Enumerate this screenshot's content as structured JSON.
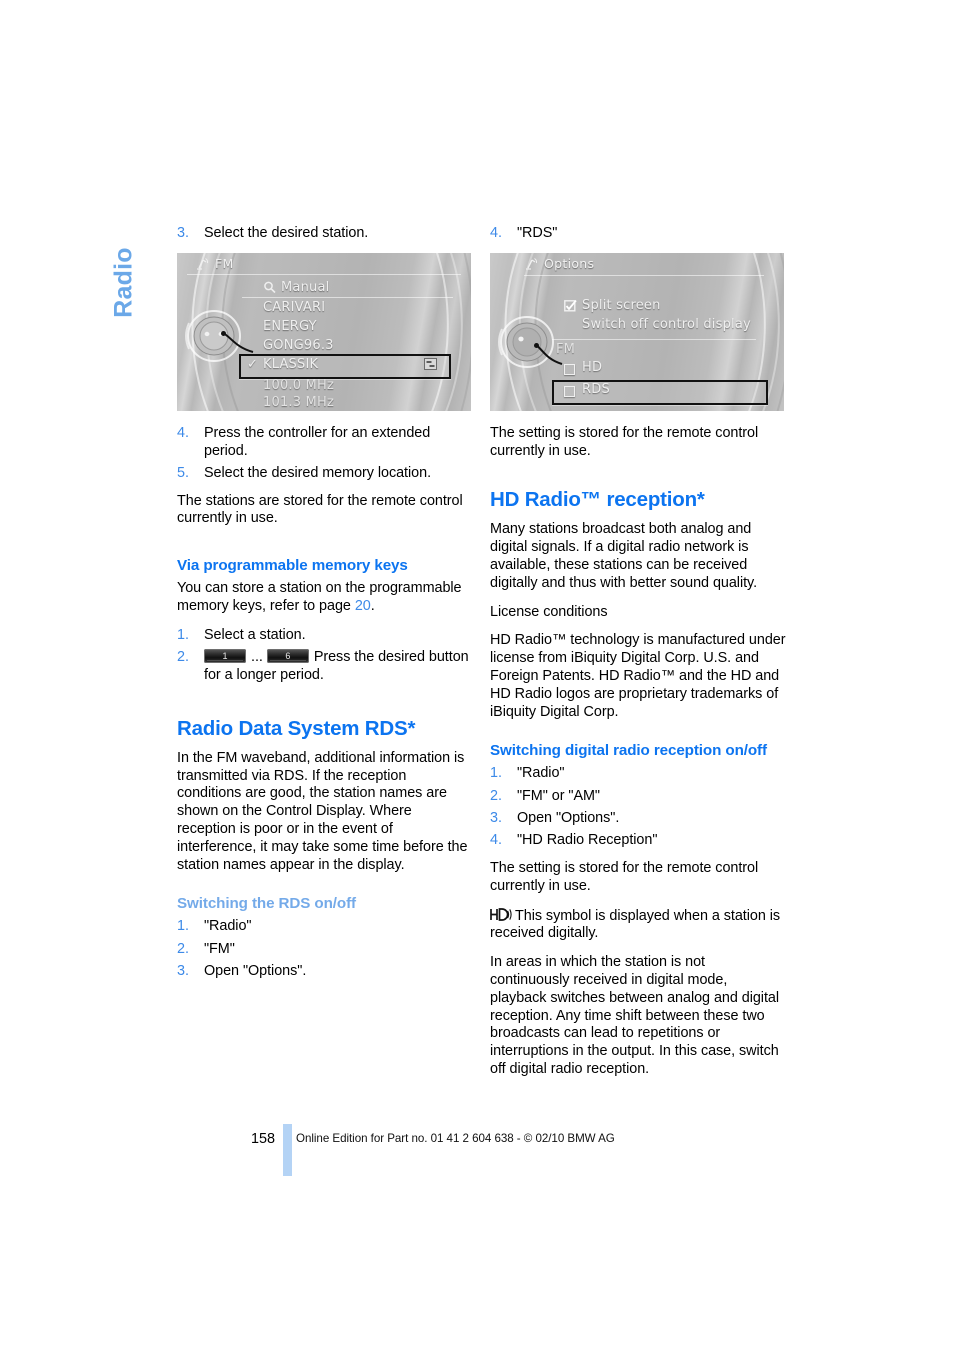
{
  "chapter_tab": "Radio",
  "left_column": {
    "step3": {
      "num": "3.",
      "text": "Select the desired station."
    },
    "screenshot1": {
      "title": "FM",
      "title_icon": "antenna-icon",
      "search_row": "Manual",
      "search_icon": "magnifier-icon",
      "stations": [
        "CARIVARI",
        "ENERGY",
        "GONG96.3"
      ],
      "selected_station": "KLASSIK",
      "selected_check": "✓",
      "selected_badge_icon": "hd-station-icon",
      "frequencies": [
        "100.0  MHz",
        "101.3  MHz"
      ],
      "controller_icon": "idrive-controller-icon"
    },
    "steps_45": [
      {
        "num": "4.",
        "text": "Press the controller for an extended period."
      },
      {
        "num": "5.",
        "text": "Select the desired memory location."
      }
    ],
    "stored_note": "The stations are stored for the remote control currently in use.",
    "memory_keys_heading": "Via programmable memory keys",
    "memory_keys_intro_a": "You can store a station on the programmable memory keys, refer to page ",
    "memory_keys_intro_page": "20",
    "memory_keys_intro_b": ".",
    "memkey_steps": [
      {
        "num": "1.",
        "text": "Select a station."
      }
    ],
    "memkey_step2": {
      "num": "2.",
      "key_first": "1",
      "ellipsis": "...",
      "key_last": "6",
      "text": "Press the desired button for a longer period."
    },
    "rds_heading": "Radio Data System RDS*",
    "rds_body": "In the FM waveband, additional information is transmitted via RDS. If the reception conditions are good, the station names are shown on the Control Display. Where reception is poor or in the event of interference, it may take some time before the station names appear in the display.",
    "rds_switch_heading": "Switching the RDS on/off",
    "rds_switch_steps": [
      {
        "num": "1.",
        "text": "\"Radio\""
      },
      {
        "num": "2.",
        "text": "\"FM\""
      },
      {
        "num": "3.",
        "text": "Open \"Options\"."
      }
    ]
  },
  "right_column": {
    "step4": {
      "num": "4.",
      "text": "\"RDS\""
    },
    "screenshot2": {
      "title": "Options",
      "title_icon": "antenna-icon",
      "split_screen_label": "Split screen",
      "split_screen_checked": true,
      "switch_off_label": "Switch off control display",
      "group_label": "FM",
      "hd_label": "HD",
      "hd_checked": false,
      "rds_label": "RDS",
      "rds_checked": false,
      "controller_icon": "idrive-controller-icon"
    },
    "stored_note": "The setting is stored for the remote control currently in use.",
    "hd_heading": "HD Radio™ reception*",
    "hd_body": "Many stations broadcast both analog and digital signals. If a digital radio network is available, these stations can be received digitally and thus with better sound quality.",
    "license_label": "License conditions",
    "license_body": "HD Radio™ technology is manufactured under license from iBiquity Digital Corp. U.S. and Foreign Patents. HD Radio™ and the HD and HD Radio logos are proprietary trademarks of iBiquity Digital Corp.",
    "switch_heading": "Switching digital radio reception on/off",
    "switch_steps": [
      {
        "num": "1.",
        "text": "\"Radio\""
      },
      {
        "num": "2.",
        "text": "\"FM\" or \"AM\""
      },
      {
        "num": "3.",
        "text": "Open \"Options\"."
      },
      {
        "num": "4.",
        "text": "\"HD Radio Reception\""
      }
    ],
    "stored_note2": "The setting is stored for the remote control currently in use.",
    "symbol_note": "This symbol is displayed when a station is received digitally.",
    "symbol_icon": "hd-radio-logo-icon",
    "final_body": "In areas in which the station is not continuously received in digital mode, playback switches between analog and digital reception. Any time shift between these two broadcasts can lead to repetitions or interruptions in the output. In this case, switch off digital radio reception."
  },
  "footer": {
    "page_number": "158",
    "text": "Online Edition for Part no. 01 41 2 604 638 - © 02/10 BMW AG"
  },
  "colors": {
    "heading_blue": "#0c74f0",
    "tab_blue": "#6ba8e8",
    "number_blue": "#3d8ae8",
    "footer_bar_blue": "#b4d3f5"
  }
}
